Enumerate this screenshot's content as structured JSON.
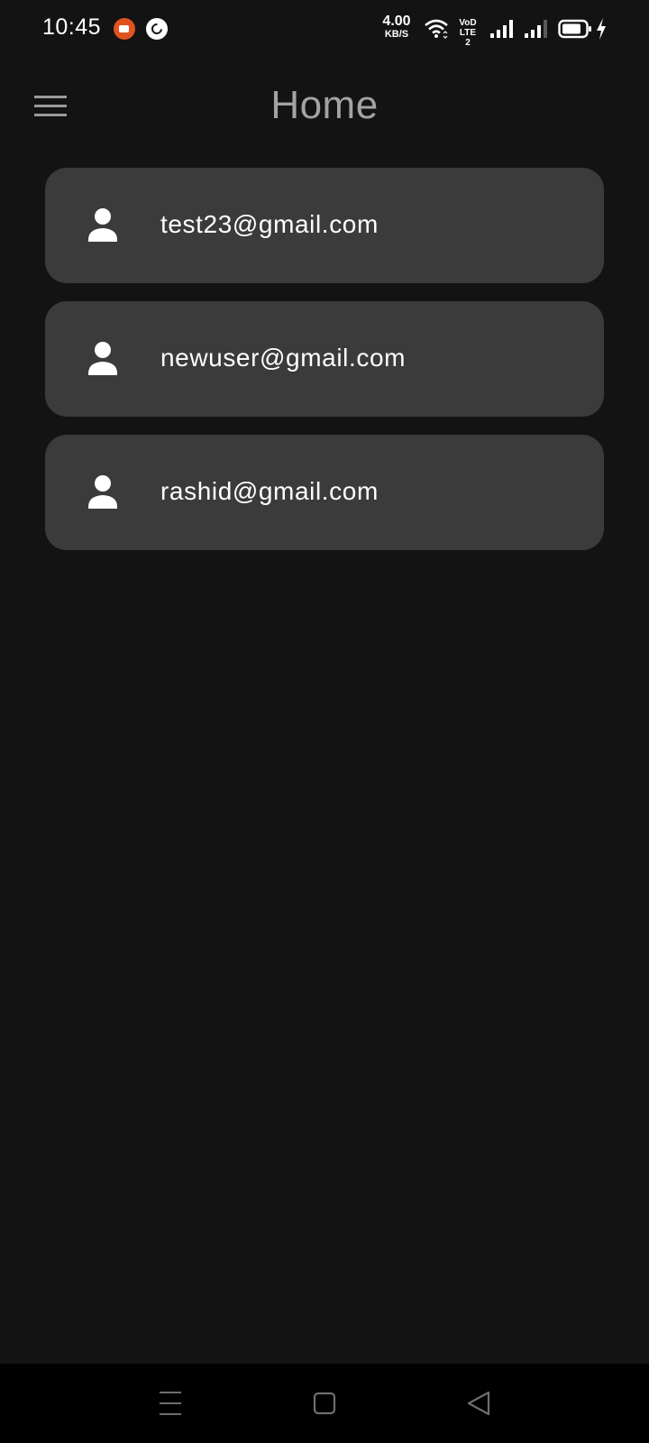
{
  "status_bar": {
    "time": "10:45",
    "notification_icons": [
      "screen-recorder-icon",
      "shazam-icon"
    ],
    "net_speed_value": "4.00",
    "net_speed_unit": "KB/S",
    "volte_label_top": "VoD",
    "volte_label_bottom": "LTE 2",
    "icons": [
      "wifi-icon",
      "signal-icon",
      "signal-icon",
      "battery-icon",
      "charging-icon"
    ]
  },
  "app_bar": {
    "title": "Home",
    "menu_icon": "menu-icon"
  },
  "users": [
    {
      "email": "test23@gmail.com",
      "icon": "person-icon"
    },
    {
      "email": "newuser@gmail.com",
      "icon": "person-icon"
    },
    {
      "email": "rashid@gmail.com",
      "icon": "person-icon"
    }
  ],
  "nav_bar": {
    "buttons": [
      "recents-icon",
      "home-icon",
      "back-icon"
    ]
  },
  "colors": {
    "background": "#131313",
    "card": "#3b3b3b",
    "title": "#a3a3a3",
    "text": "#ffffff",
    "nav_bar": "#000000",
    "recorder_accent": "#e0521f"
  }
}
